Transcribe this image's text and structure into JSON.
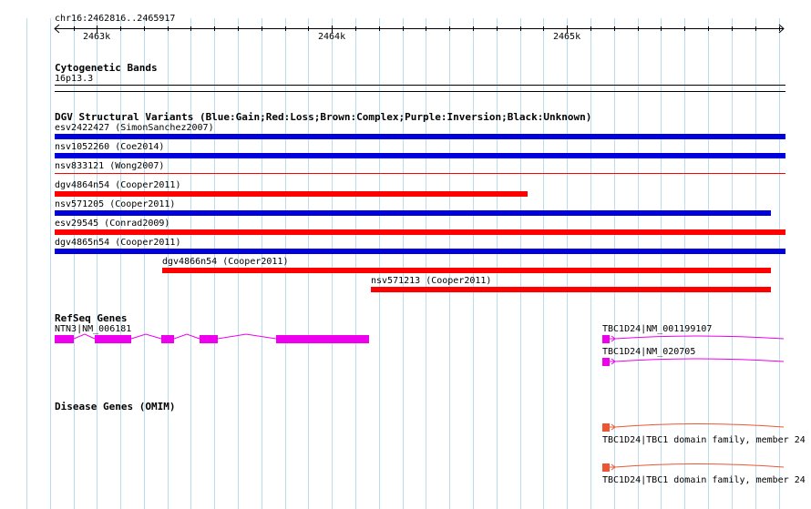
{
  "ruler": {
    "region_label": "chr16:2462816..2465917",
    "ticks": [
      "2463k",
      "2464k",
      "2465k"
    ]
  },
  "tracks": {
    "cytoband": {
      "title": "Cytogenetic Bands",
      "band_label": "16p13.3"
    },
    "dgv": {
      "title": "DGV Structural Variants (Blue:Gain;Red:Loss;Brown:Complex;Purple:Inversion;Black:Unknown)",
      "variants": [
        {
          "label": "esv2422427 (SimonSanchez2007)",
          "type": "gain"
        },
        {
          "label": "nsv1052260 (Coe2014)",
          "type": "gain"
        },
        {
          "label": "nsv833121 (Wong2007)",
          "type": "loss"
        },
        {
          "label": "dgv4864n54 (Cooper2011)",
          "type": "loss"
        },
        {
          "label": "nsv571205 (Cooper2011)",
          "type": "gain"
        },
        {
          "label": "esv29545 (Conrad2009)",
          "type": "loss"
        },
        {
          "label": "dgv4865n54 (Cooper2011)",
          "type": "gain"
        },
        {
          "label": "dgv4866n54 (Cooper2011)",
          "type": "loss"
        },
        {
          "label": "nsv571213 (Cooper2011)",
          "type": "loss"
        }
      ]
    },
    "refseq": {
      "title": "RefSeq Genes",
      "genes": [
        {
          "label": "NTN3|NM_006181"
        },
        {
          "label": "TBC1D24|NM_001199107"
        },
        {
          "label": "TBC1D24|NM_020705"
        }
      ]
    },
    "omim": {
      "title": "Disease Genes (OMIM)",
      "genes": [
        {
          "label": "TBC1D24|TBC1 domain family, member 24"
        },
        {
          "label": "TBC1D24|TBC1 domain family, member 24"
        }
      ]
    }
  },
  "colors": {
    "gain": "#0000dd",
    "loss": "#ff0000",
    "refseq": "#ee00ee",
    "omim": "#ee5533",
    "grid": "#b9dcef"
  }
}
